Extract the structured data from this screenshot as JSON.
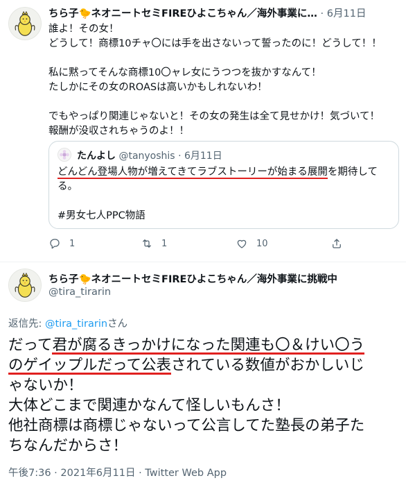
{
  "tweet1": {
    "display_name": "ちら子🐤ネオニートセミFIREひよこちゃん／海外事業に…",
    "separator": "·",
    "time": "6月11日",
    "more": "···",
    "lines": [
      "誰よ！その女！",
      "どうして！商標10チャ〇には手を出さないって誓ったのに！どうして！！",
      "",
      "私に黙ってそんな商標10〇ャレ女にうつつを抜かすなんて！",
      "たしかにその女のROASは高いかもしれないわ！",
      "",
      "でもやっぱり関連じゃないと！その女の発生は全て見せかけ！気づいて！",
      "報酬が没収されちゃうのよ！！"
    ],
    "quoted": {
      "display_name": "たんよし",
      "handle": "@tanyoshis",
      "separator": "·",
      "time": "6月11日",
      "line1_underlined": "どんどん登場人物が増えてきてラブストーリーが始まる展開",
      "line1_rest": "を期待して",
      "line2": "る。",
      "hashtag": "#男女七人PPC物語"
    },
    "actions": {
      "reply_count": "1",
      "retweet_count": "1",
      "like_count": "10"
    }
  },
  "tweet2": {
    "display_name": "ちら子🐤ネオニートセミFIREひよこちゃん／海外事業に挑戦中",
    "handle": "@tira_tirarin",
    "more": "···",
    "reply_label": "返信先: ",
    "reply_handle": "@tira_tirarin",
    "reply_suffix": "さん",
    "body": {
      "l1_a": "だって",
      "l1_u": "君が腐るきっかけになった関連も〇＆けい〇う",
      "l2_u": "のゲイップルだって公表",
      "l2_b": "されている数値がおかしいじ",
      "l3": "ゃないか！",
      "l4": "大体どこまで関連かなんて怪しいもんさ！",
      "l5": "他社商標は商標じゃないって公言してた塾長の弟子た",
      "l6": "ちなんだからさ！"
    },
    "footer": "午後7:36 · 2021年6月11日 · Twitter Web App"
  },
  "icons": {
    "reply": "reply-icon",
    "retweet": "retweet-icon",
    "like": "heart-icon",
    "share": "share-icon",
    "avatar": "chick-mascot-avatar"
  },
  "colors": {
    "text": "#0f1419",
    "secondary": "#536471",
    "link": "#1d9bf0",
    "underline": "#e0201f",
    "border": "#cfd9de"
  }
}
